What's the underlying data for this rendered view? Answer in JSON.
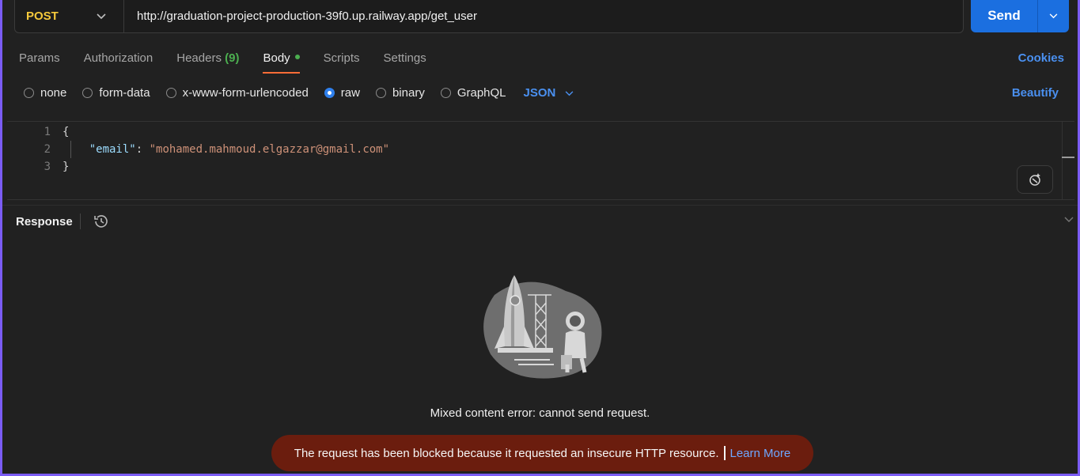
{
  "request": {
    "method": "POST",
    "url": "http://graduation-project-production-39f0.up.railway.app/get_user",
    "send_label": "Send"
  },
  "tabs": [
    {
      "label": "Params"
    },
    {
      "label": "Authorization"
    },
    {
      "label": "Headers",
      "count": "(9)"
    },
    {
      "label": "Body",
      "active": true
    },
    {
      "label": "Scripts"
    },
    {
      "label": "Settings"
    }
  ],
  "cookies_label": "Cookies",
  "body_types": [
    {
      "label": "none"
    },
    {
      "label": "form-data"
    },
    {
      "label": "x-www-form-urlencoded"
    },
    {
      "label": "raw",
      "selected": true
    },
    {
      "label": "binary"
    },
    {
      "label": "GraphQL"
    }
  ],
  "format": "JSON",
  "beautify_label": "Beautify",
  "editor": {
    "line_numbers": [
      "1",
      "2",
      "3"
    ],
    "open_brace": "{",
    "key": "\"email\"",
    "colon": ": ",
    "value": "\"mohamed.mahmoud.elgazzar@gmail.com\"",
    "close_brace": "}"
  },
  "response": {
    "title": "Response",
    "error_message": "Mixed content error: cannot send request.",
    "banner_text": "The request has been blocked because it requested an insecure HTTP resource.",
    "banner_link": "Learn More"
  },
  "icons": {
    "method_dropdown": "chevron-down-icon",
    "send_dropdown": "chevron-down-icon",
    "format_dropdown": "chevron-down-icon",
    "history": "history-icon",
    "magic": "ai-assist-icon",
    "collapse": "chevron-down-icon"
  },
  "colors": {
    "accent": "#1b6fe0",
    "method": "#f5c93b",
    "link": "#4a90f0",
    "active_tab": "#ff6c37",
    "banner_bg": "#6b1d0e",
    "frame": "#7b5cf5"
  }
}
